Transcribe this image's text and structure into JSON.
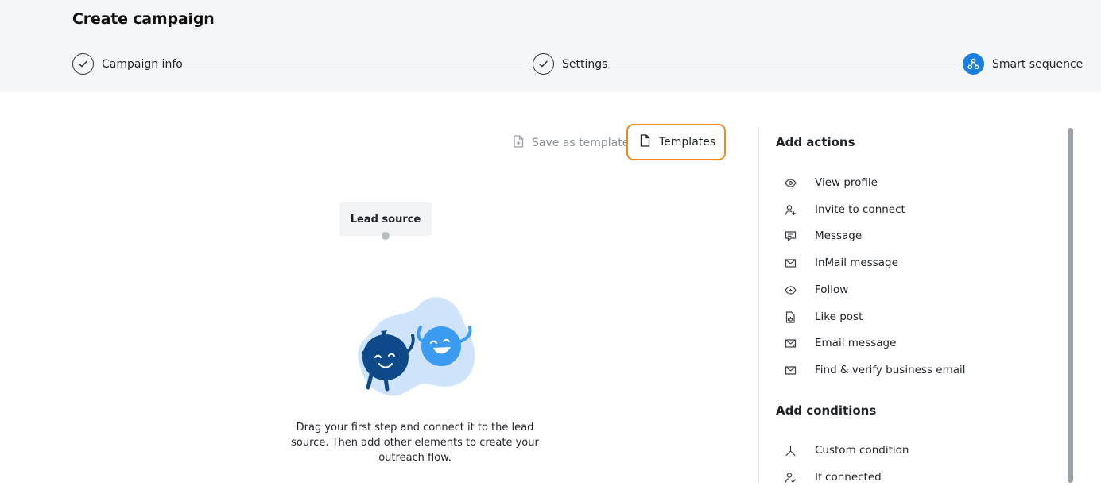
{
  "header": {
    "title": "Create campaign"
  },
  "stepper": {
    "steps": [
      {
        "label": "Campaign info",
        "state": "done"
      },
      {
        "label": "Settings",
        "state": "done"
      },
      {
        "label": "Smart sequence",
        "state": "active"
      }
    ]
  },
  "toolbar": {
    "save_as_template": "Save as template",
    "templates": "Templates"
  },
  "canvas": {
    "lead_source": "Lead source",
    "hint": "Drag your first step and connect it to the lead source. Then add other elements to create your outreach flow."
  },
  "panel": {
    "actions_heading": "Add actions",
    "actions": [
      {
        "label": "View profile",
        "icon": "eye-icon"
      },
      {
        "label": "Invite to connect",
        "icon": "user-plus-icon"
      },
      {
        "label": "Message",
        "icon": "message-icon"
      },
      {
        "label": "InMail message",
        "icon": "inmail-icon"
      },
      {
        "label": "Follow",
        "icon": "follow-icon"
      },
      {
        "label": "Like post",
        "icon": "like-post-icon"
      },
      {
        "label": "Email message",
        "icon": "email-icon"
      },
      {
        "label": "Find & verify business email",
        "icon": "find-email-icon"
      }
    ],
    "conditions_heading": "Add conditions",
    "conditions": [
      {
        "label": "Custom condition",
        "icon": "branch-icon"
      },
      {
        "label": "If connected",
        "icon": "user-check-icon"
      }
    ]
  },
  "colors": {
    "accent": "#1b7fe0",
    "highlight": "#f08a1c",
    "mascot_dark": "#0e4a8a",
    "mascot_light": "#3b9bf0",
    "blob": "#cfe4fb"
  }
}
